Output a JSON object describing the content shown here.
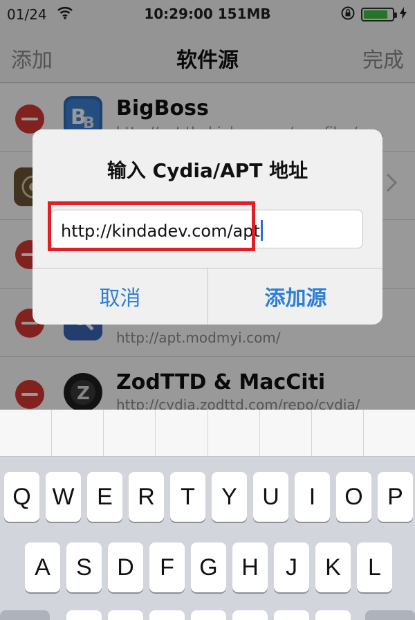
{
  "status_bar": {
    "date": "01/24",
    "wifi_icon": "wifi-icon",
    "time_memory": "10:29:00 151MB",
    "lock_icon": "orientation-lock-icon",
    "battery_level": 0.85,
    "battery_color": "#3cc341",
    "charging_icon": "bolt-icon"
  },
  "nav": {
    "left": "添加",
    "title": "软件源",
    "right": "完成"
  },
  "sources": [
    {
      "title": "BigBoss",
      "url": "http://apt.thebigboss.org/repofiles/cy..."
    },
    {
      "title": "",
      "url": ""
    },
    {
      "title": "",
      "url": ""
    },
    {
      "title": "",
      "url": "http://apt.modmyi.com/"
    },
    {
      "title": "ZodTTD & MacCiti",
      "url": "http://cydia.zodttd.com/repo/cydia/"
    }
  ],
  "alert": {
    "title": "输入 Cydia/APT 地址",
    "input_value": "http://kindadev.com/apt",
    "cancel": "取消",
    "add": "添加源"
  },
  "keyboard": {
    "row1": [
      "Q",
      "W",
      "E",
      "R",
      "T",
      "Y",
      "U",
      "I",
      "O",
      "P"
    ],
    "row2": [
      "A",
      "S",
      "D",
      "F",
      "G",
      "H",
      "J",
      "K",
      "L"
    ]
  },
  "colors": {
    "accent": "#2e7fd9",
    "delete": "#d93a32",
    "highlight": "#e01f26"
  }
}
